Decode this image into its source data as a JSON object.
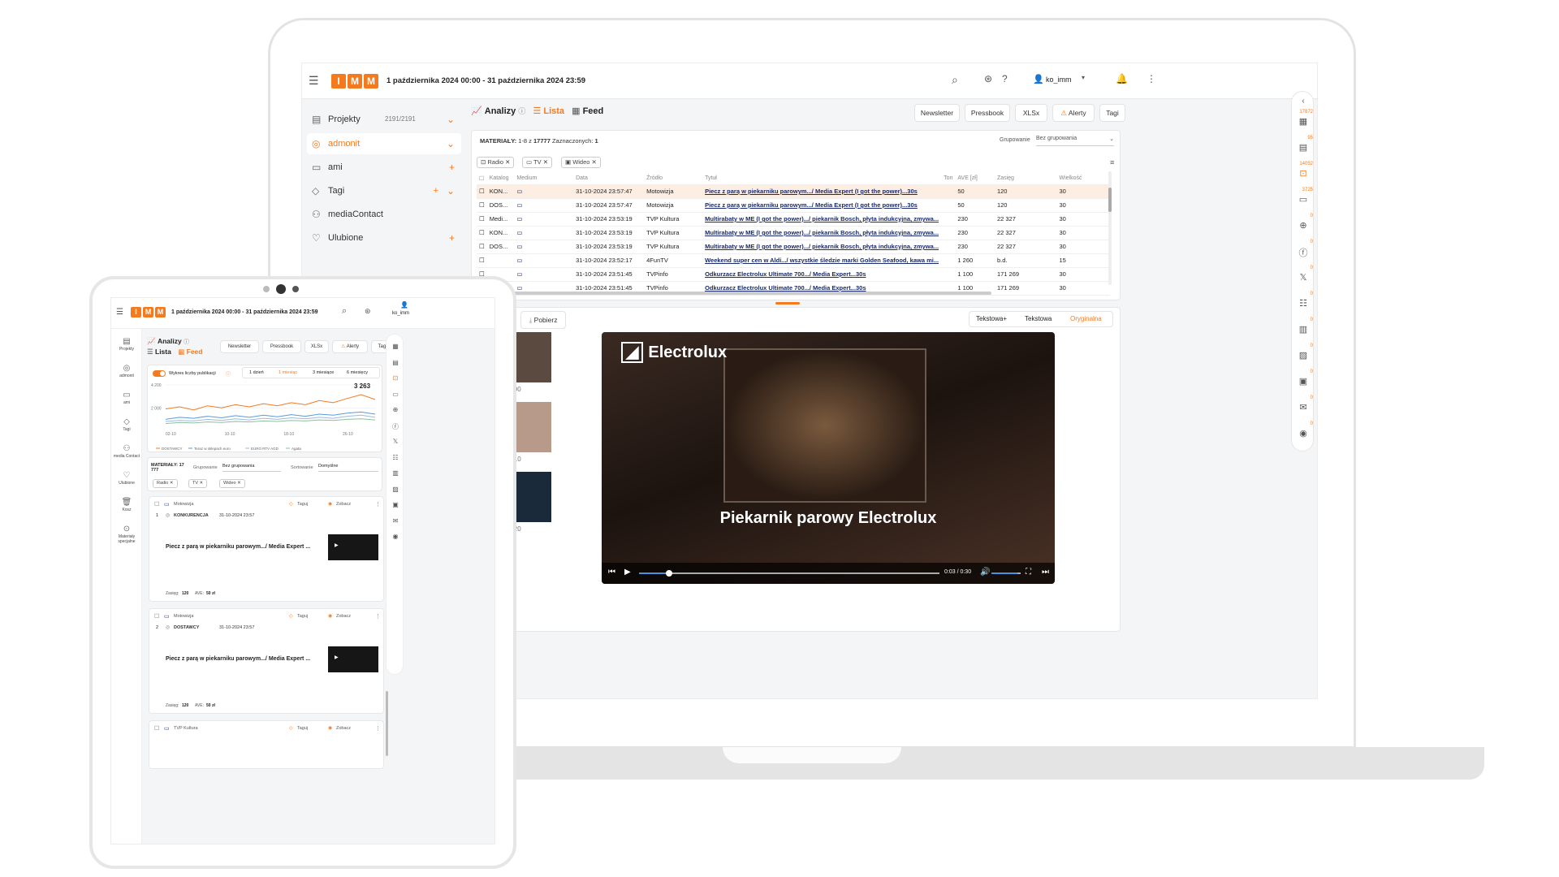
{
  "app": {
    "logo_letters": [
      "I",
      "M",
      "M"
    ],
    "date_range": "1 października 2024 00:00 - 31 października 2024 23:59",
    "user": "ko_imm",
    "accent": "#f47a20"
  },
  "sidebar": {
    "items": [
      {
        "label": "Projekty",
        "count": "2191/2191",
        "icon": "projects-icon"
      },
      {
        "label": "admonit",
        "icon": "radar-icon"
      },
      {
        "label": "ami",
        "icon": "monitor-icon"
      },
      {
        "label": "Tagi",
        "icon": "tag-icon"
      },
      {
        "label": "mediaContact",
        "icon": "people-icon"
      },
      {
        "label": "Ulubione",
        "icon": "heart-icon"
      }
    ]
  },
  "main": {
    "view_tabs": [
      "Analizy",
      "Lista",
      "Feed"
    ],
    "toolbar": [
      "Newsletter",
      "Pressbook",
      "XLSx",
      "Alerty",
      "Tagi"
    ],
    "materials_label": "MATERIAŁY:",
    "materials_range": "1-8 z",
    "materials_total": "17777",
    "selected_label": "Zaznaczonych:",
    "selected_count": "1",
    "grouping_label": "Grupowanie",
    "grouping_value": "Bez grupowania",
    "filters": [
      "Radio",
      "TV",
      "Wideo"
    ],
    "columns": [
      "Katalog",
      "Medium",
      "Data",
      "Źródło",
      "Tytuł",
      "Ton",
      "AVE [zł]",
      "Zasięg",
      "Wielkość"
    ],
    "rows": [
      {
        "katalog": "KON...",
        "data": "31-10-2024 23:57:47",
        "zrodlo": "Motowizja",
        "tytul": "Piecz z parą w piekarniku parowym.../ Media Expert (I got the power)...30s",
        "ave": "50",
        "zasieg": "120",
        "wielkosc": "30"
      },
      {
        "katalog": "DOS...",
        "data": "31-10-2024 23:57:47",
        "zrodlo": "Motowizja",
        "tytul": "Piecz z parą w piekarniku parowym.../ Media Expert (I got the power)...30s",
        "ave": "50",
        "zasieg": "120",
        "wielkosc": "30"
      },
      {
        "katalog": "Medi...",
        "data": "31-10-2024 23:53:19",
        "zrodlo": "TVP Kultura",
        "tytul": "Multirabaty w ME (I got the power).../ piekarnik Bosch, płyta indukcyjna, zmywa...",
        "ave": "230",
        "zasieg": "22 327",
        "wielkosc": "30"
      },
      {
        "katalog": "KON...",
        "data": "31-10-2024 23:53:19",
        "zrodlo": "TVP Kultura",
        "tytul": "Multirabaty w ME (I got the power).../ piekarnik Bosch, płyta indukcyjna, zmywa...",
        "ave": "230",
        "zasieg": "22 327",
        "wielkosc": "30"
      },
      {
        "katalog": "DOS...",
        "data": "31-10-2024 23:53:19",
        "zrodlo": "TVP Kultura",
        "tytul": "Multirabaty w ME (I got the power).../ piekarnik Bosch, płyta indukcyjna, zmywa...",
        "ave": "230",
        "zasieg": "22 327",
        "wielkosc": "30"
      },
      {
        "katalog": "",
        "data": "31-10-2024 23:52:17",
        "zrodlo": "4FunTV",
        "tytul": "Weekend super cen w Aldi.../ wszystkie śledzie marki Golden Seafood, kawa mi...",
        "ave": "1 260",
        "zasieg": "b.d.",
        "wielkosc": "15"
      },
      {
        "katalog": "",
        "data": "31-10-2024 23:51:45",
        "zrodlo": "TVPinfo",
        "tytul": "Odkurzacz Electrolux Ultimate 700.../ Media Expert...30s",
        "ave": "1 100",
        "zasieg": "171 269",
        "wielkosc": "30"
      },
      {
        "katalog": "",
        "data": "31-10-2024 23:51:45",
        "zrodlo": "TVPinfo",
        "tytul": "Odkurzacz Electrolux Ultimate 700.../ Media Expert...30s",
        "ave": "1 100",
        "zasieg": "171 269",
        "wielkosc": "30"
      }
    ],
    "download_label": "Pobierz",
    "transcript_tabs": [
      "Tekstowa+",
      "Tekstowa",
      "Oryginalna"
    ],
    "thumb_times": [
      "0:00:00",
      "0:00:10",
      "0:00:20"
    ],
    "video": {
      "brand": "Electrolux",
      "caption": "Piekarnik parowy Electrolux",
      "time": "0:03 / 0:30",
      "progress": 0.1,
      "volume": 0.9
    }
  },
  "rail": {
    "counts": [
      "17872",
      "95",
      "14052",
      "3725",
      "0",
      "0",
      "0",
      "0",
      "0",
      "0",
      "0",
      "0",
      "0"
    ]
  },
  "tablet": {
    "date_range": "1 października 2024 00:00 - 31 października 2024 23:59",
    "user": "ko_imm",
    "side": [
      "Projekty",
      "admonit",
      "ami",
      "Tagi",
      "media Contact",
      "Ulubione",
      "Kosz",
      "Materiały specjalne"
    ],
    "tabs": [
      "Analizy",
      "Lista",
      "Feed"
    ],
    "toolbar": [
      "Newsletter",
      "Pressbook",
      "XLSx",
      "Alerty",
      "Tagi"
    ],
    "chart_toggle_label": "Wykres liczby publikacji",
    "ranges": [
      "1 dzień",
      "1 miesiąc",
      "3 miesiące",
      "6 miesięcy"
    ],
    "materials_label": "MATERIAŁY: 17 777",
    "grouping_label": "Grupowanie",
    "grouping_value": "Bez grupowania",
    "sorting_label": "Sortowanie",
    "sorting_value": "Domyślne",
    "filters": [
      "Radio",
      "TV",
      "Wideo"
    ],
    "card_tag": "Taguj",
    "card_see": "Zobacz",
    "cards": [
      {
        "source": "Motowizja",
        "num": "1",
        "cat": "KONKURENCJA",
        "date": "31-10-2024 23:57",
        "title": "Piecz z parą w piekarniku parowym.../ Media Expert ...",
        "zasieg_label": "Zasięg:",
        "zasieg": "120",
        "ave_label": "AVE:",
        "ave": "50 zł"
      },
      {
        "source": "Motowizja",
        "num": "2",
        "cat": "DOSTAWCY",
        "date": "31-10-2024 23:57",
        "title": "Piecz z parą w piekarniku parowym.../ Media Expert ...",
        "zasieg_label": "Zasięg:",
        "zasieg": "120",
        "ave_label": "AVE:",
        "ave": "50 zł"
      },
      {
        "source": "TVP Kultura",
        "num": "",
        "cat": "",
        "date": "",
        "title": "",
        "zasieg_label": "",
        "zasieg": "",
        "ave_label": "",
        "ave": ""
      }
    ]
  },
  "chart_data": {
    "type": "line",
    "x": [
      "02-10",
      "10-10",
      "18-10",
      "26-10"
    ],
    "y_ticks": [
      "4 200",
      "2 000"
    ],
    "ylim": [
      0,
      4200
    ],
    "peak_label": "3 263",
    "series": [
      {
        "name": "DOSTAWCY",
        "color": "#f47a20",
        "values": [
          1900,
          2100,
          1800,
          2200,
          2000,
          2300,
          2100,
          2400,
          2200,
          2500,
          2300,
          2700,
          2500,
          2900,
          3263,
          2800
        ]
      },
      {
        "name": "Teraz w sklepach euro",
        "color": "#5b9bd5",
        "values": [
          900,
          1100,
          1000,
          1200,
          1050,
          1250,
          1100,
          1300,
          1150,
          1350,
          1200,
          1400,
          1300,
          1500,
          1600,
          1400
        ]
      },
      {
        "name": "EURO RTV AGD",
        "color": "#9bbbd9",
        "values": [
          700,
          800,
          750,
          900,
          800,
          950,
          850,
          1000,
          900,
          1050,
          950,
          1100,
          1000,
          1200,
          1300,
          1100
        ]
      },
      {
        "name": "Agata",
        "color": "#8fbf9f",
        "values": [
          500,
          600,
          550,
          650,
          600,
          700,
          650,
          750,
          700,
          800,
          750,
          850,
          800,
          900,
          950,
          850
        ]
      }
    ]
  }
}
